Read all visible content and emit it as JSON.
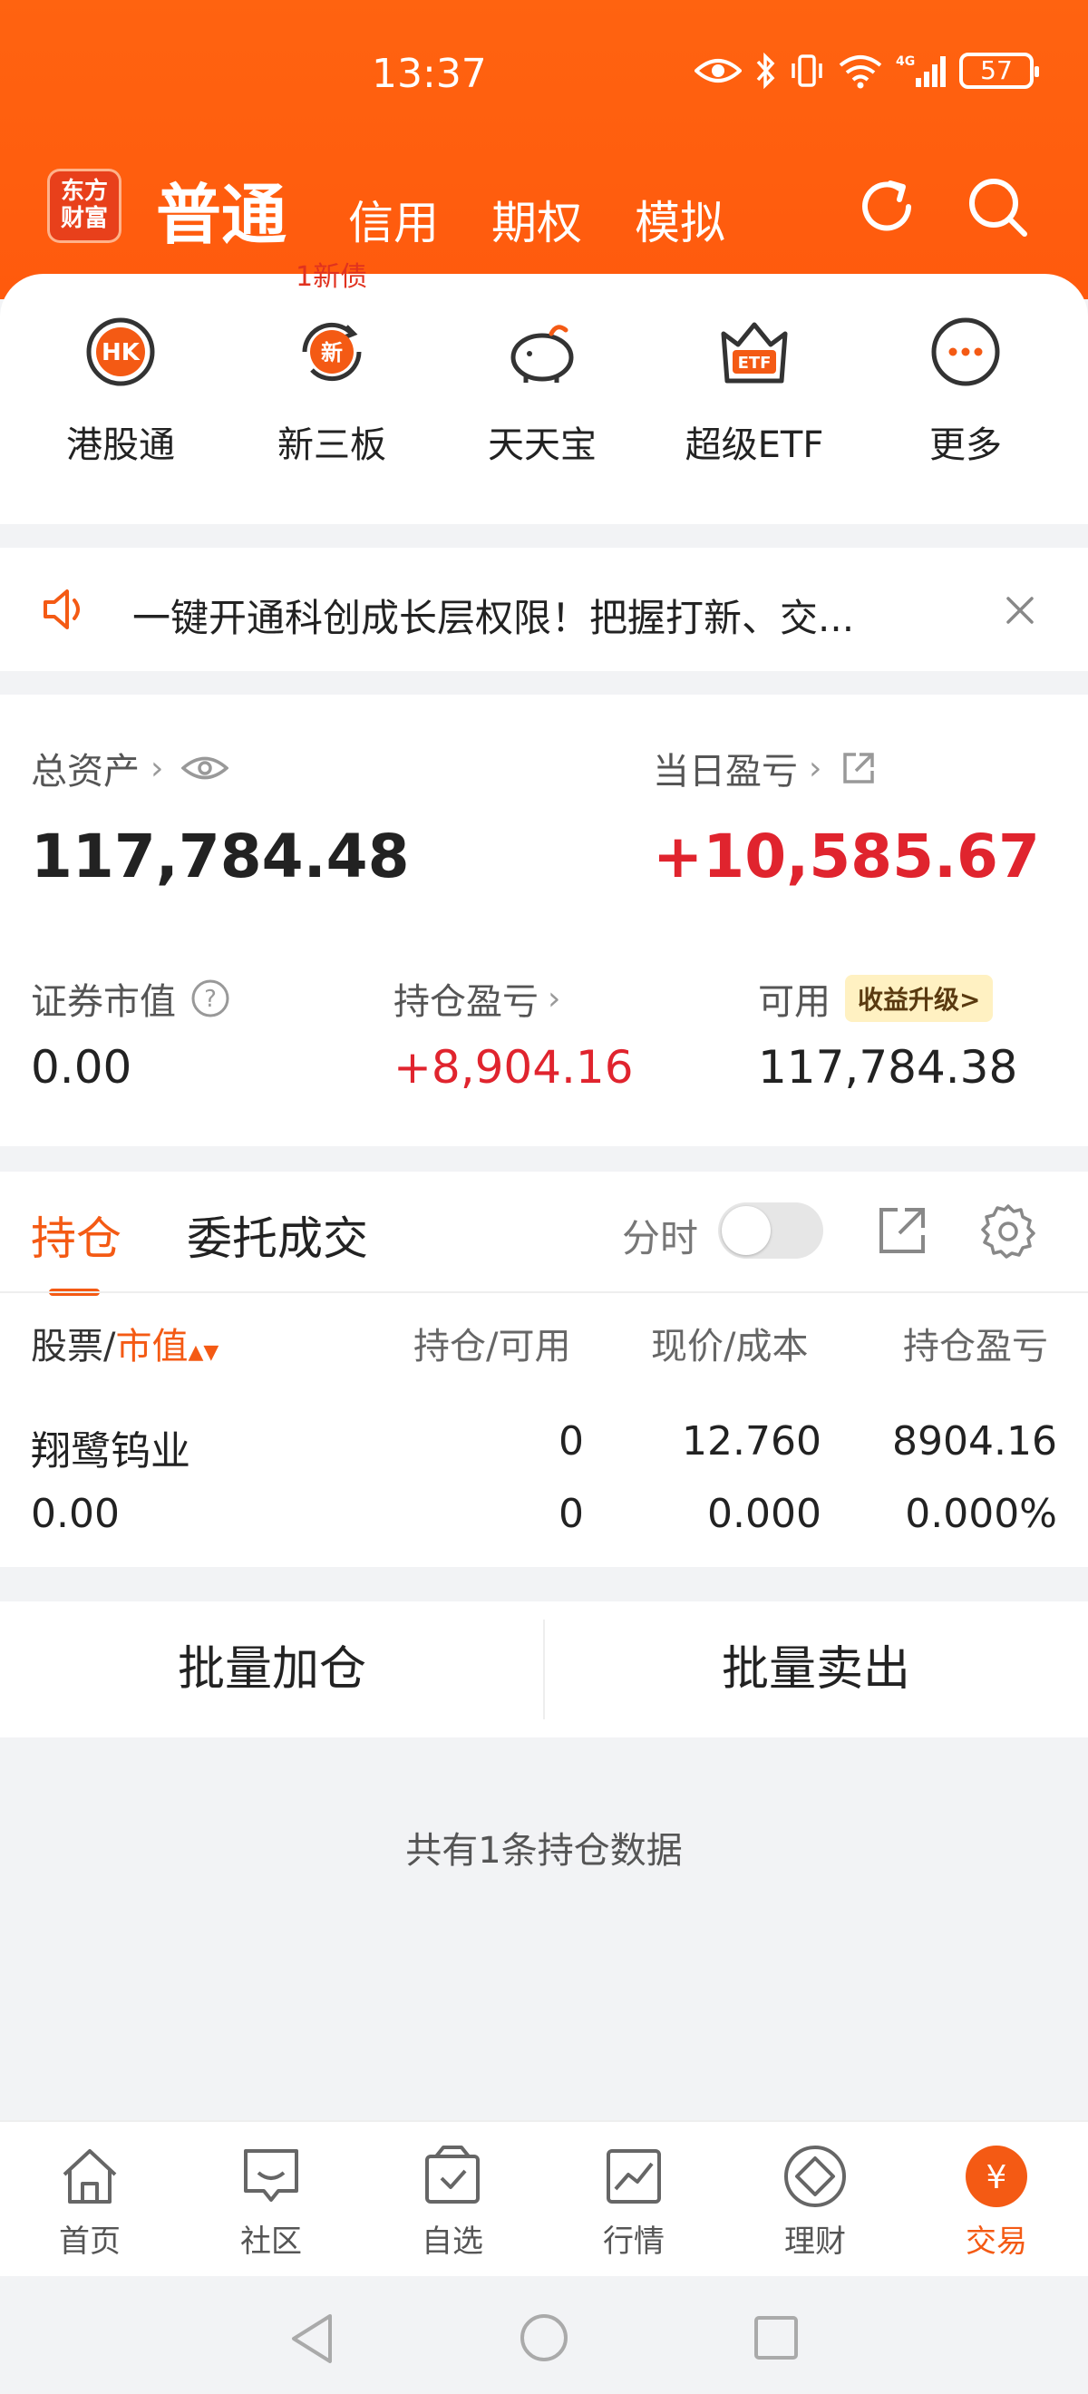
{
  "status": {
    "time": "13:37",
    "battery": "57"
  },
  "header": {
    "logo_line1": "东方",
    "logo_line2": "财富",
    "tabs": [
      "普通",
      "信用",
      "期权",
      "模拟"
    ],
    "new_debt_badge": "1新债"
  },
  "quick_menu": [
    {
      "label": "港股通",
      "icon": "hk-icon"
    },
    {
      "label": "新三板",
      "icon": "new-board-icon"
    },
    {
      "label": "天天宝",
      "icon": "piggy-bank-icon"
    },
    {
      "label": "超级ETF",
      "icon": "etf-icon"
    },
    {
      "label": "更多",
      "icon": "more-icon"
    }
  ],
  "notice": {
    "text": "一键开通科创成长层权限！把握打新、交..."
  },
  "assets": {
    "total_label": "总资产",
    "total_value": "117,784.48",
    "daily_pl_label": "当日盈亏",
    "daily_pl_value": "+10,585.67",
    "market_value_label": "证券市值",
    "market_value": "0.00",
    "position_pl_label": "持仓盈亏",
    "position_pl_value": "+8,904.16",
    "available_label": "可用",
    "available_badge": "收益升级>",
    "available_value": "117,784.38"
  },
  "positions": {
    "tabs": [
      "持仓",
      "委托成交"
    ],
    "timeshare_label": "分时",
    "headers": {
      "stock": "股票",
      "slash": "/",
      "market_value": "市值",
      "holding": "持仓/可用",
      "price": "现价/成本",
      "pl": "持仓盈亏"
    },
    "rows": [
      {
        "name": "翔鹭钨业",
        "value": "0.00",
        "holding": "0",
        "available": "0",
        "price": "12.760",
        "cost": "0.000",
        "pl": "8904.16",
        "pl_pct": "0.000%"
      }
    ]
  },
  "batch": {
    "add": "批量加仓",
    "sell": "批量卖出"
  },
  "count_text": "共有1条持仓数据",
  "bottom_nav": [
    "首页",
    "社区",
    "自选",
    "行情",
    "理财",
    "交易"
  ],
  "colors": {
    "brand": "#ff5f0f",
    "up": "#e0242e",
    "badge_bg": "#fff1c2"
  }
}
